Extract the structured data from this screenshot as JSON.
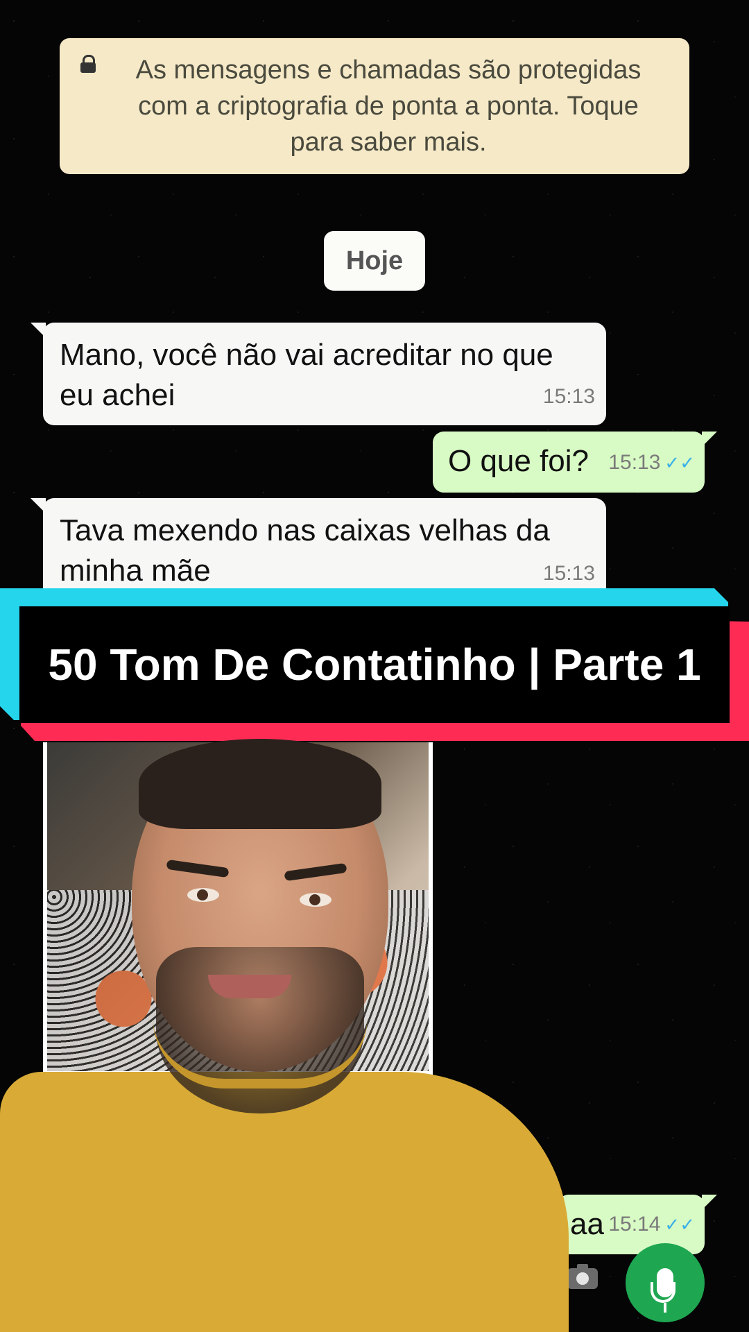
{
  "encryption_notice": "As mensagens e chamadas são protegidas com a criptografia de ponta a ponta. Toque para saber mais.",
  "date_divider": "Hoje",
  "messages": [
    {
      "direction": "incoming",
      "text": "Mano, você não vai acreditar no que eu achei",
      "time": "15:13"
    },
    {
      "direction": "outgoing",
      "text": "O que foi?",
      "time": "15:13",
      "status": "read"
    },
    {
      "direction": "incoming",
      "text": "Tava mexendo nas caixas velhas da minha mãe",
      "time": "15:13"
    },
    {
      "direction": "outgoing",
      "text": "aa",
      "time": "15:14",
      "status": "read"
    }
  ],
  "banner_title": "50 Tom De Contatinho | Parte 1",
  "icons": {
    "lock": "lock-icon",
    "mic": "microphone-icon",
    "camera": "camera-icon",
    "tick": "double-check-icon"
  },
  "colors": {
    "incoming": "#f7f7f5",
    "outgoing": "#d8fac4",
    "notice": "#f6e9c7",
    "banner_cyan": "#25d5ec",
    "banner_pink": "#fe2c55",
    "mic": "#1ea651"
  }
}
